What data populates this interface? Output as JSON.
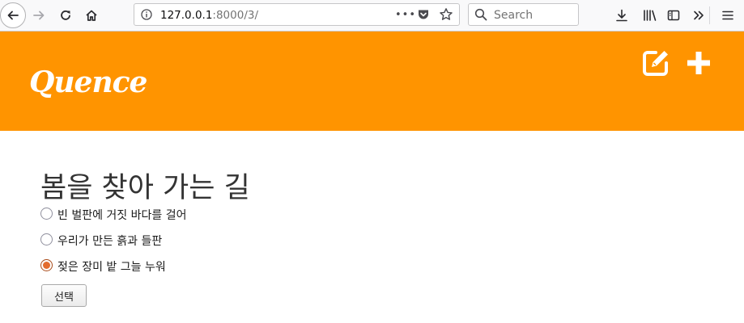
{
  "browser": {
    "url_host": "127.0.0.1",
    "url_rest": ":8000/3/",
    "url_more_label": "•••",
    "search_placeholder": "Search"
  },
  "header": {
    "brand": "Quence",
    "background_color": "#ff9400",
    "edit_icon": "edit-square-icon",
    "add_icon": "plus-icon"
  },
  "question": {
    "title": "봄을 찾아 가는 길",
    "choices": [
      {
        "label": "빈 벌판에 거짓 바다를 걸어",
        "selected": false
      },
      {
        "label": "우리가 만든 흙과 들판",
        "selected": false
      },
      {
        "label": "젖은 장미 밭 그늘 누워",
        "selected": true
      }
    ],
    "submit_label": "선택"
  }
}
